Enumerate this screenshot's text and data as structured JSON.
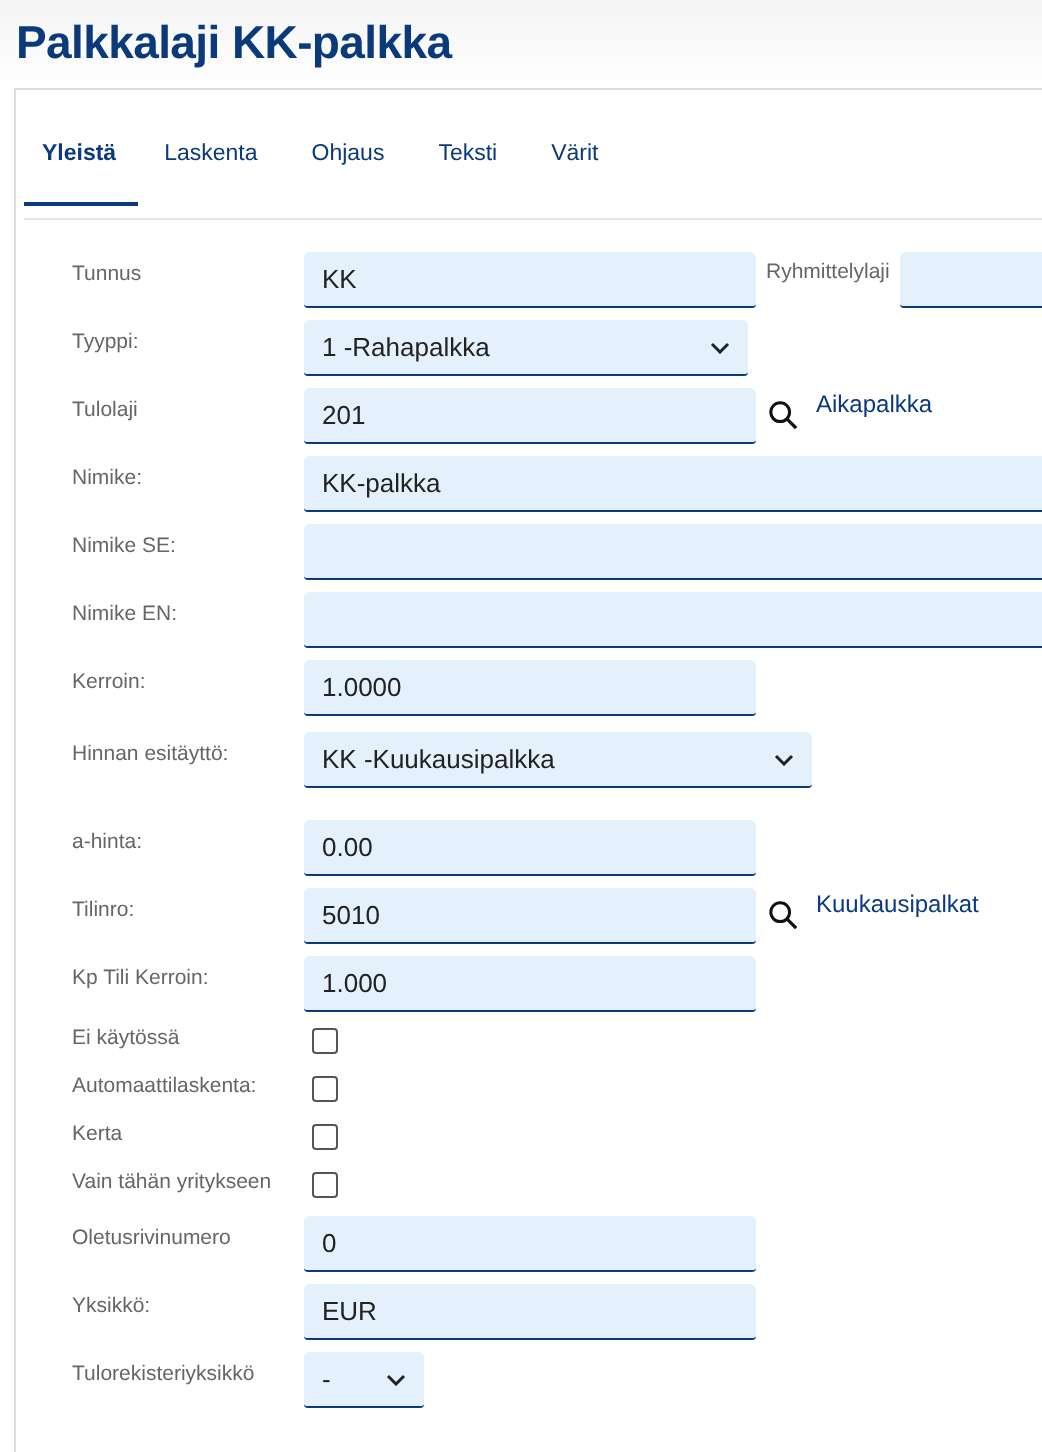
{
  "title": "Palkkalaji KK-palkka",
  "tabs": [
    {
      "label": "Yleistä",
      "selected": true
    },
    {
      "label": "Laskenta",
      "selected": false
    },
    {
      "label": "Ohjaus",
      "selected": false
    },
    {
      "label": "Teksti",
      "selected": false
    },
    {
      "label": "Värit",
      "selected": false
    }
  ],
  "rows": [
    {
      "label": "Tunnus",
      "kind": "text",
      "value": "KK",
      "side_field": {
        "label": "Ryhmittelylaji"
      }
    },
    {
      "label": "Tyyppi:",
      "kind": "select",
      "value": "1 -Rahapalkka"
    },
    {
      "label": "Tulolaji",
      "kind": "text",
      "value": "201",
      "lookup": "Aikapalkka"
    },
    {
      "label": "Nimike:",
      "kind": "wide_text",
      "value": "KK-palkka"
    },
    {
      "label": "Nimike SE:",
      "kind": "wide_text"
    },
    {
      "label": "Nimike EN:",
      "kind": "wide_text"
    },
    {
      "label": "Kerroin:",
      "kind": "text",
      "value": "1.0000"
    },
    {
      "label": "Hinnan esitäyttö:",
      "kind": "wide_select",
      "value": "KK -Kuukausipalkka"
    },
    {
      "label": "a-hinta:",
      "kind": "text",
      "value": "0.00"
    },
    {
      "label": "Tilinro:",
      "kind": "text",
      "value": "5010",
      "lookup": "Kuukausipalkat"
    },
    {
      "label": "Kp Tili Kerroin:",
      "kind": "text",
      "value": "1.000"
    },
    {
      "label": "Ei käytössä",
      "kind": "checkbox",
      "checked": false
    },
    {
      "label": "Automaattilaskenta:",
      "kind": "checkbox",
      "checked": false
    },
    {
      "label": "Kerta",
      "kind": "checkbox",
      "checked": false
    },
    {
      "label": "Vain tähän yritykseen",
      "kind": "checkbox",
      "checked": false
    },
    {
      "label": "Oletusrivinumero",
      "kind": "text",
      "value": "0"
    },
    {
      "label": "Yksikkö:",
      "kind": "text",
      "value": "EUR"
    },
    {
      "label": "Tulorekisteriyksikkö",
      "kind": "narrow_select",
      "value": "-"
    }
  ]
}
